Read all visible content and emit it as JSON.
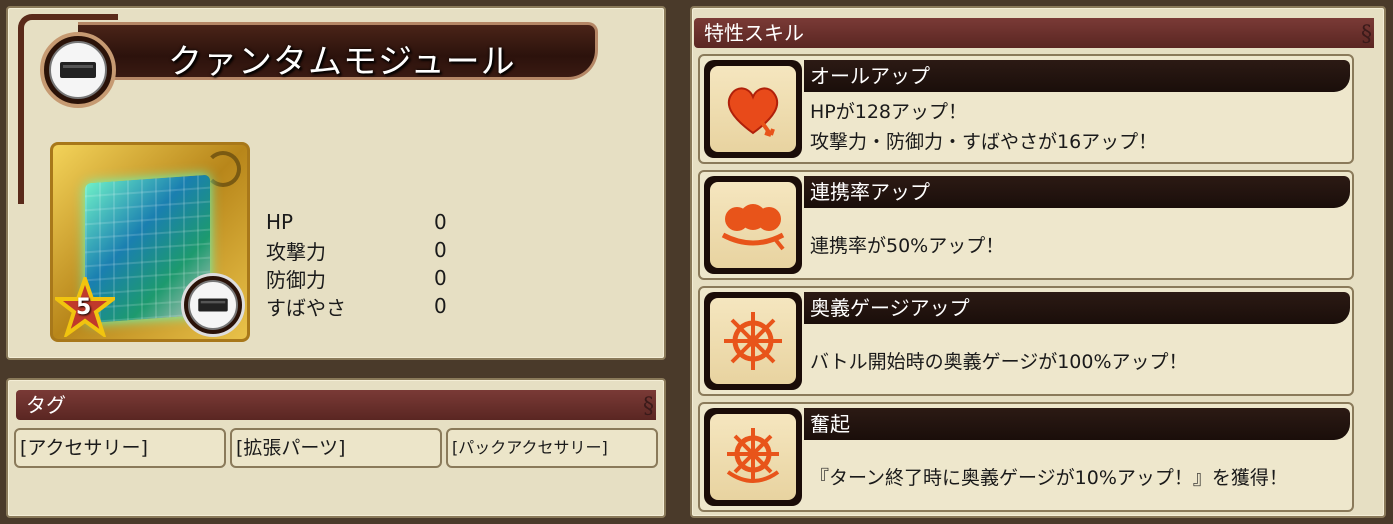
{
  "item": {
    "name": "クァンタムモジュール",
    "rarity": "5",
    "icon": "module-icon",
    "stats": [
      {
        "label": "HP",
        "value": "0"
      },
      {
        "label": "攻撃力",
        "value": "0"
      },
      {
        "label": "防御力",
        "value": "0"
      },
      {
        "label": "すばやさ",
        "value": "0"
      }
    ]
  },
  "tags": {
    "header": "タグ",
    "items": [
      "[アクセサリー]",
      "[拡張パーツ]",
      "[パックアクセサリー]"
    ]
  },
  "skills": {
    "header": "特性スキル",
    "items": [
      {
        "name": "オールアップ",
        "icon": "heart-up-icon",
        "desc1": "HPが128アップ！",
        "desc2": "攻撃力・防御力・すばやさが16アップ！"
      },
      {
        "name": "連携率アップ",
        "icon": "link-rate-icon",
        "desc1": "連携率が50%アップ！",
        "desc2": ""
      },
      {
        "name": "奥義ゲージアップ",
        "icon": "gauge-wheel-icon",
        "desc1": "バトル開始時の奥義ゲージが100%アップ！",
        "desc2": ""
      },
      {
        "name": "奮起",
        "icon": "rouse-wheel-icon",
        "desc1": "『ターン終了時に奥義ゲージが10%アップ！』を獲得！",
        "desc2": ""
      }
    ]
  },
  "colors": {
    "panel": "#e6dfc3",
    "header": "#6a2e2a",
    "skill_name_bg": "#1a0e0a",
    "icon_orange": "#e8541a"
  }
}
